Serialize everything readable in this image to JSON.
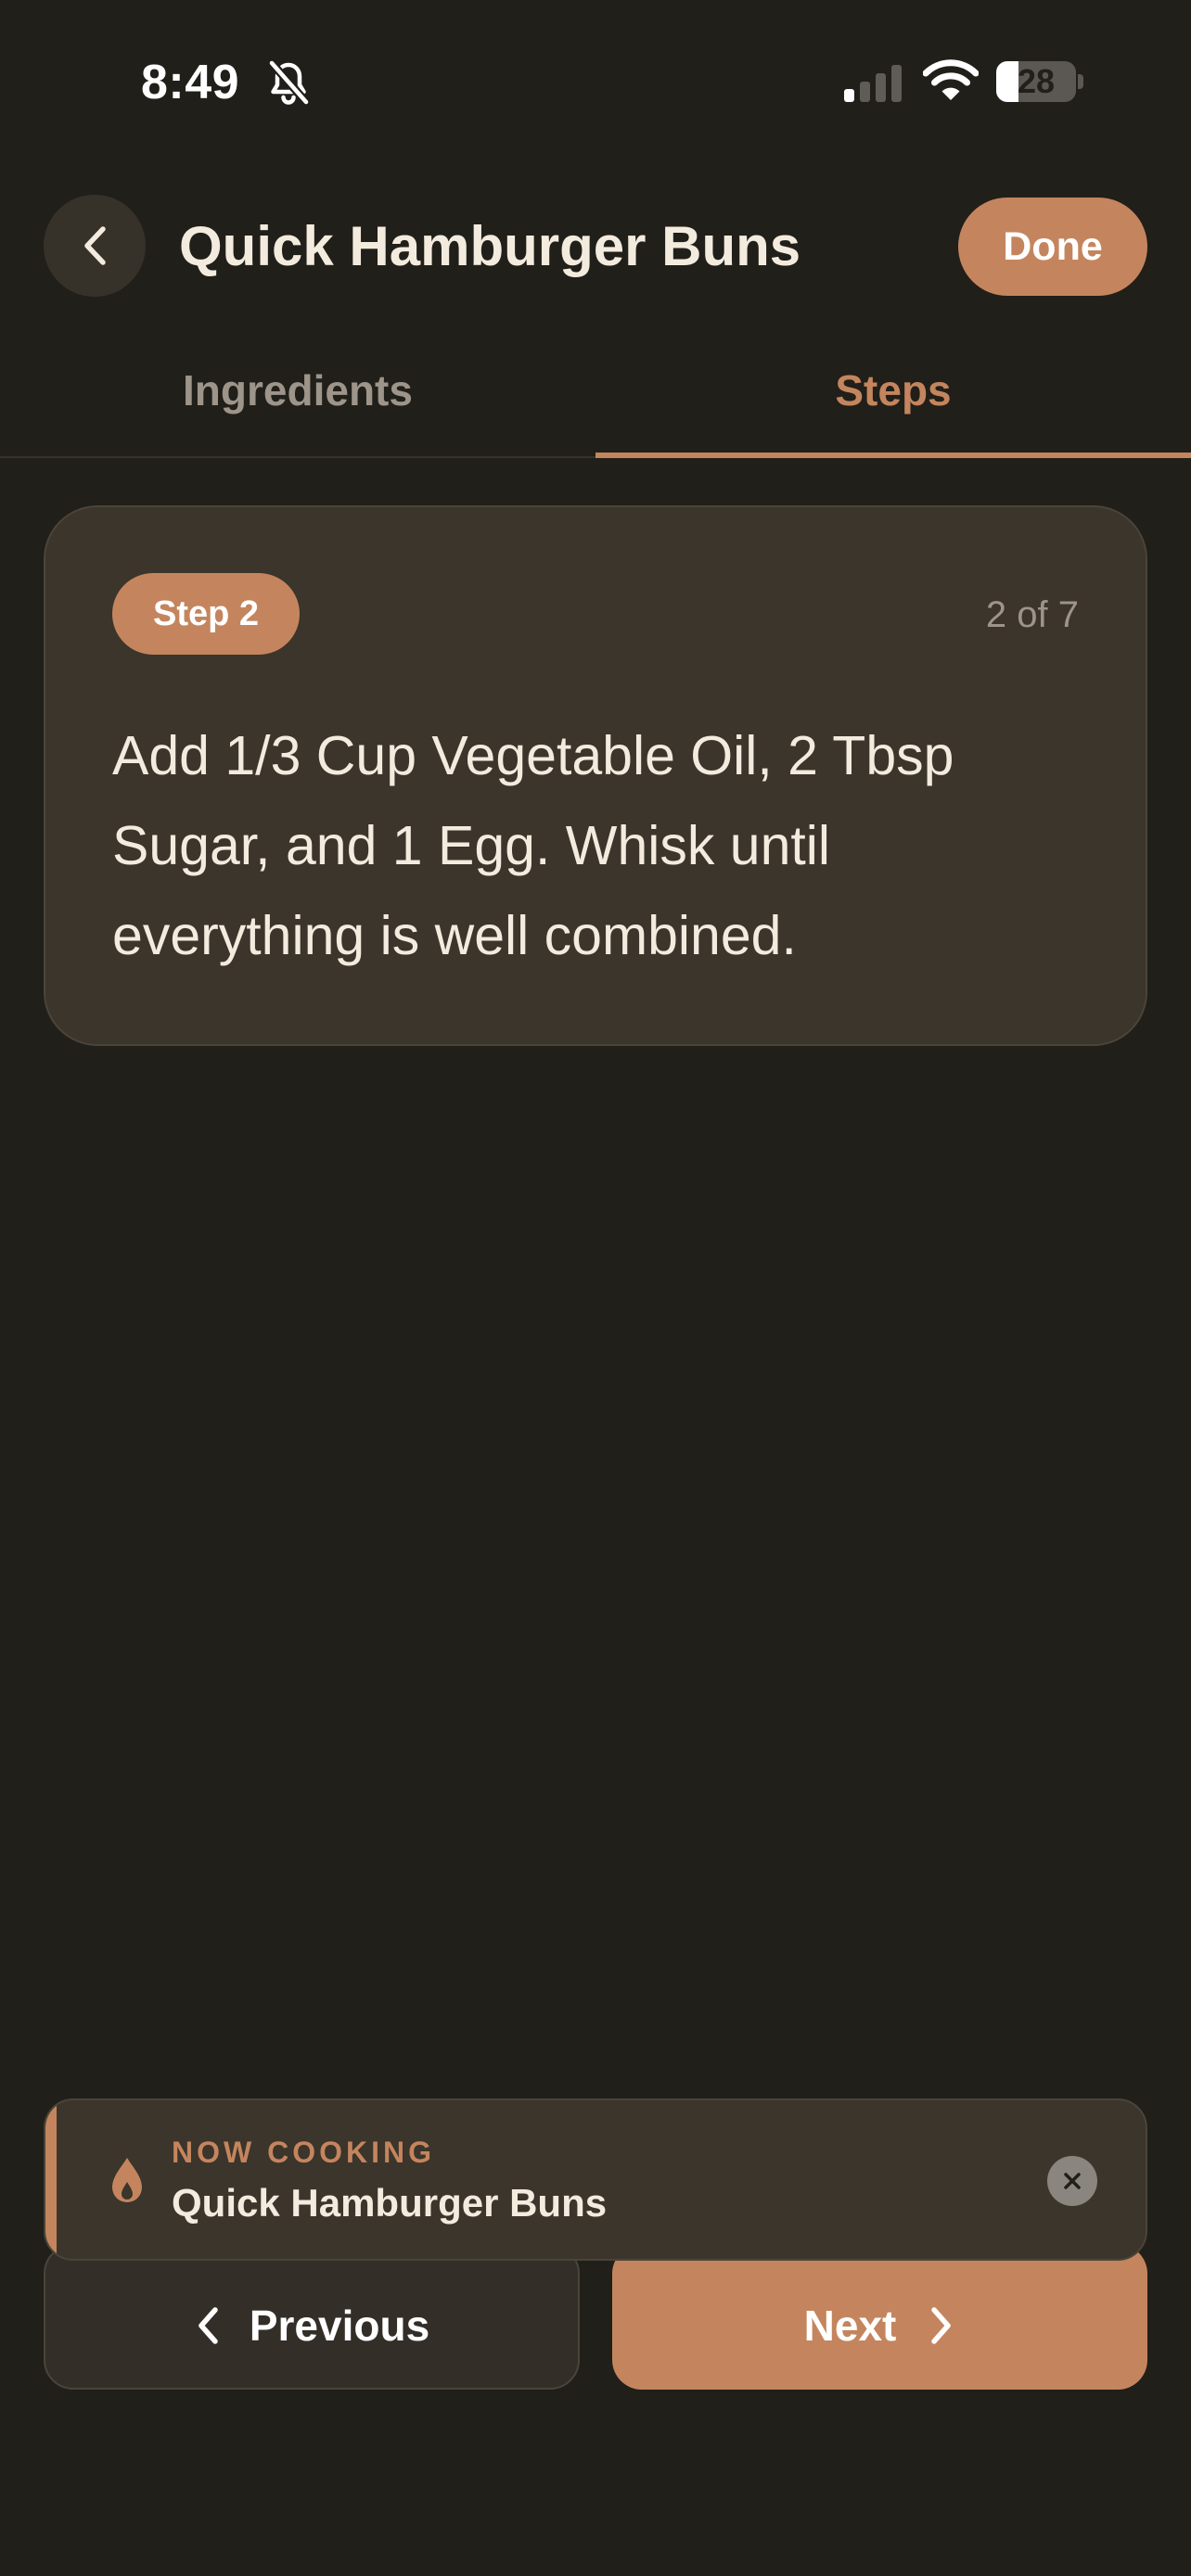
{
  "status_bar": {
    "time": "8:49",
    "battery_level": "28",
    "battery_fraction": 0.28,
    "icons": [
      "bell-slash-icon",
      "cellular-signal-icon",
      "wifi-icon",
      "battery-icon"
    ]
  },
  "header": {
    "back_icon": "chevron-left-icon",
    "title": "Quick Hamburger Buns",
    "done_label": "Done"
  },
  "tabs": [
    {
      "label": "Ingredients",
      "active": false
    },
    {
      "label": "Steps",
      "active": true
    }
  ],
  "step": {
    "badge": "Step 2",
    "counter": "2 of 7",
    "text": "Add 1/3 Cup Vegetable Oil, 2 Tbsp Sugar, and 1 Egg. Whisk until everything is well combined."
  },
  "now_cooking": {
    "label": "NOW COOKING",
    "title": "Quick Hamburger Buns",
    "icon": "flame-icon",
    "close_icon": "close-icon"
  },
  "navigation": {
    "previous_label": "Previous",
    "next_label": "Next"
  },
  "colors": {
    "background": "#211f19",
    "card": "#3b352b",
    "accent": "#c4855e",
    "text_primary": "#f3ebde",
    "text_muted": "#9d948a"
  }
}
